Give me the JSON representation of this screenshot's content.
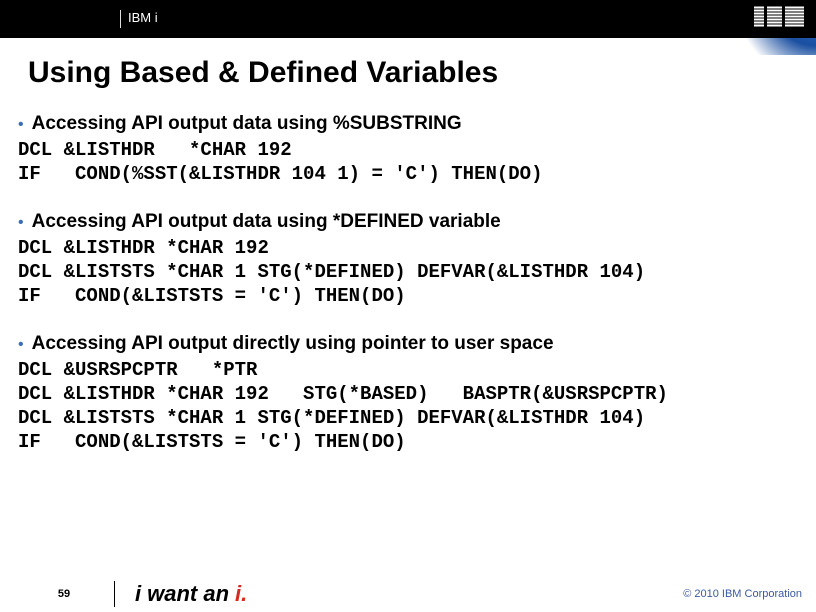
{
  "header": {
    "product": "IBM i",
    "logo_text": "IBM"
  },
  "title": "Using Based & Defined Variables",
  "sections": {
    "s1": {
      "bullet": "Accessing API output data using %SUBSTRING",
      "code": "DCL &LISTHDR   *CHAR 192\nIF   COND(%SST(&LISTHDR 104 1) = 'C') THEN(DO)"
    },
    "s2": {
      "bullet": "Accessing API output data using *DEFINED variable",
      "code": "DCL &LISTHDR *CHAR 192\nDCL &LISTSTS *CHAR 1 STG(*DEFINED) DEFVAR(&LISTHDR 104)\nIF   COND(&LISTSTS = 'C') THEN(DO)"
    },
    "s3": {
      "bullet": "Accessing API output directly using pointer to user space",
      "code": "DCL &USRSPCPTR   *PTR\nDCL &LISTHDR *CHAR 192   STG(*BASED)   BASPTR(&USRSPCPTR)\nDCL &LISTSTS *CHAR 1 STG(*DEFINED) DEFVAR(&LISTHDR 104)\nIF   COND(&LISTSTS = 'C') THEN(DO)"
    }
  },
  "footer": {
    "page": "59",
    "tagline_part1": "i",
    "tagline_part2": "want an",
    "tagline_part3": "i.",
    "copyright": "© 2010 IBM Corporation"
  }
}
